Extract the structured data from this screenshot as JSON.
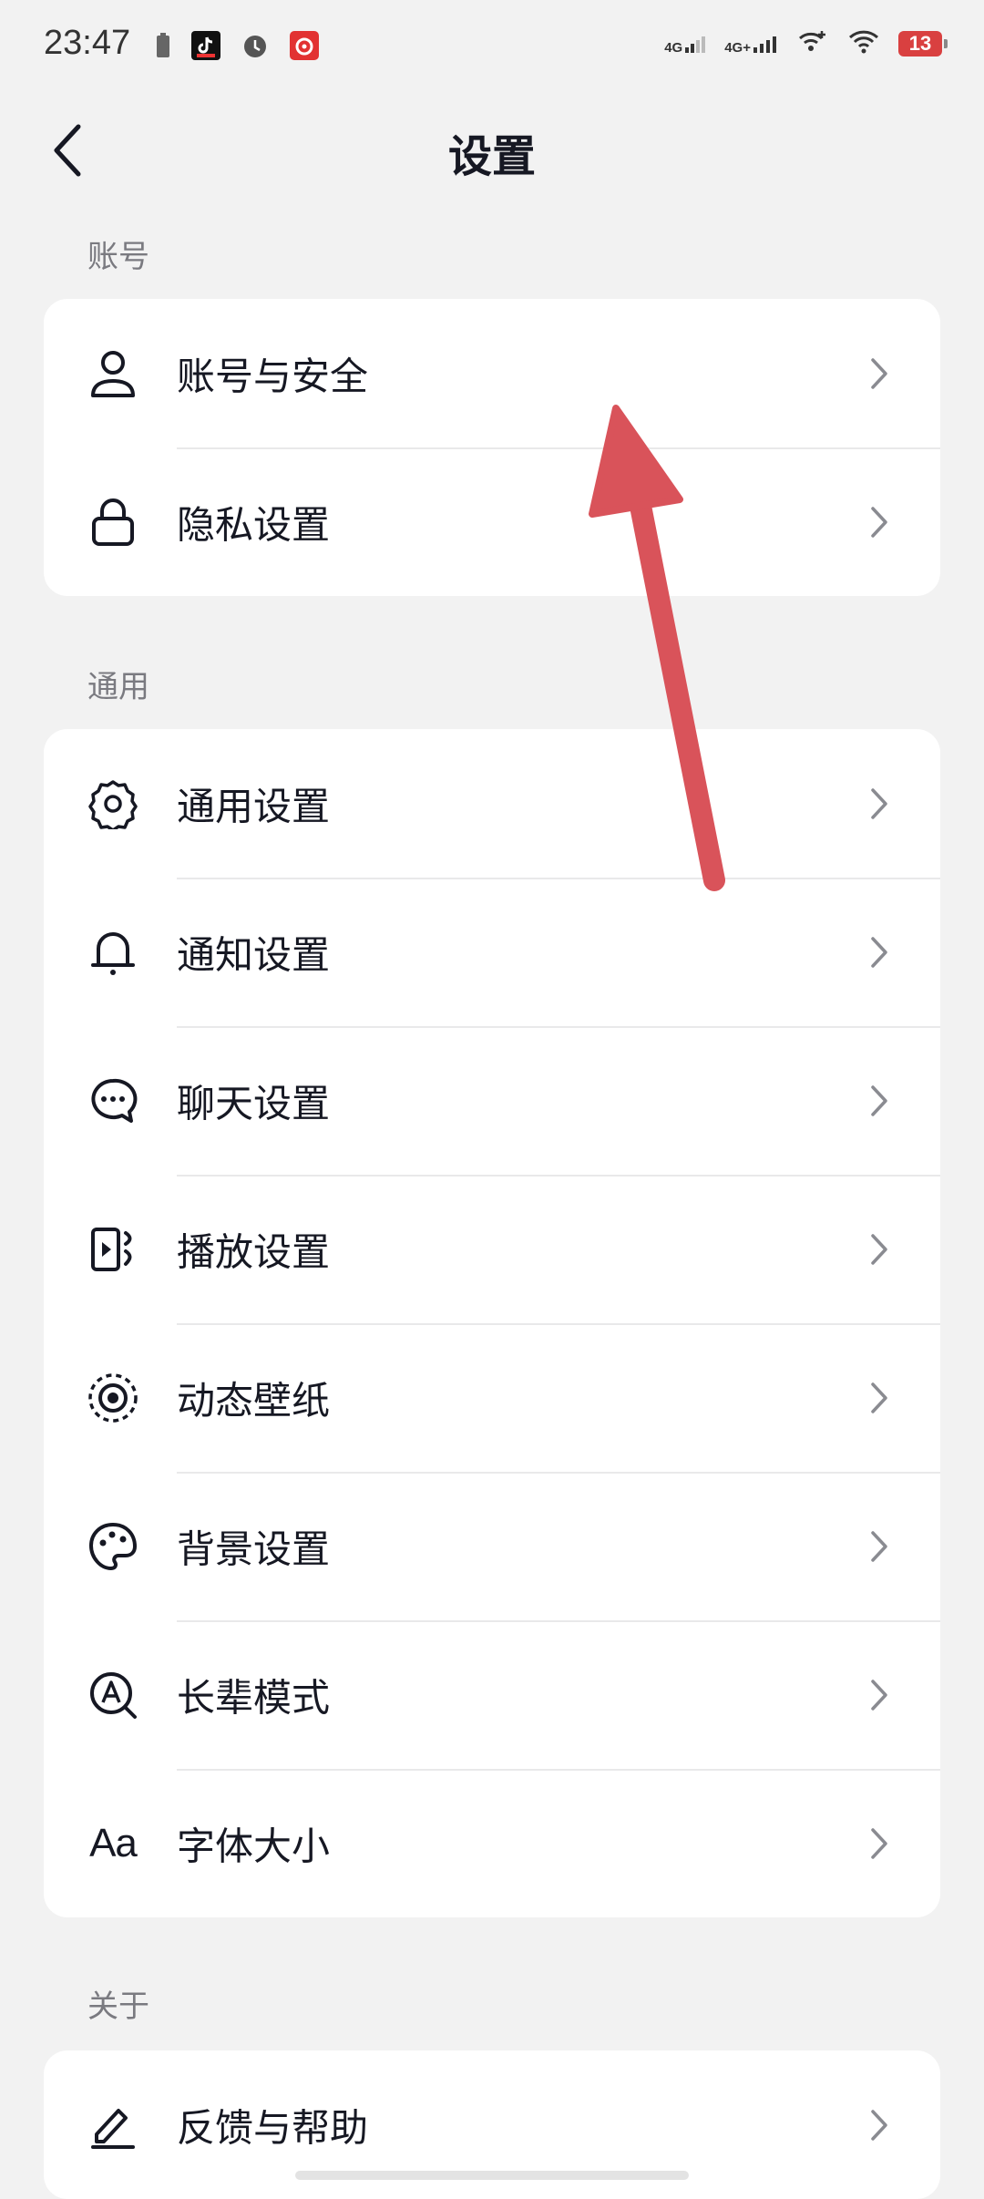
{
  "status_bar": {
    "time": "23:47",
    "signal_1": "4G",
    "signal_2": "4G+",
    "battery_level": "13",
    "battery_color": "#d94040",
    "left_icons": [
      "battery-small-icon",
      "tiktok-icon",
      "alarm-icon",
      "netease-music-icon"
    ],
    "right_icons": [
      "signal-4g-icon",
      "signal-4g-plus-icon",
      "wifi-plus-icon",
      "wifi-icon",
      "battery-icon"
    ]
  },
  "nav": {
    "title": "设置",
    "back_icon": "chevron-left-icon"
  },
  "sections": {
    "account": {
      "label": "账号",
      "items": [
        {
          "label": "账号与安全",
          "icon": "user-icon"
        },
        {
          "label": "隐私设置",
          "icon": "lock-icon"
        }
      ]
    },
    "general": {
      "label": "通用",
      "items": [
        {
          "label": "通用设置",
          "icon": "gear-icon"
        },
        {
          "label": "通知设置",
          "icon": "bell-icon"
        },
        {
          "label": "聊天设置",
          "icon": "chat-bubble-icon"
        },
        {
          "label": "播放设置",
          "icon": "play-screen-icon"
        },
        {
          "label": "动态壁纸",
          "icon": "live-wallpaper-icon"
        },
        {
          "label": "背景设置",
          "icon": "palette-icon"
        },
        {
          "label": "长辈模式",
          "icon": "elder-mode-icon"
        },
        {
          "label": "字体大小",
          "icon": "font-size-icon",
          "icon_text": "Aa"
        }
      ]
    },
    "about": {
      "label": "关于",
      "items": [
        {
          "label": "反馈与帮助",
          "icon": "pen-icon"
        }
      ]
    }
  },
  "annotation": {
    "arrow_color": "#d9535a"
  }
}
